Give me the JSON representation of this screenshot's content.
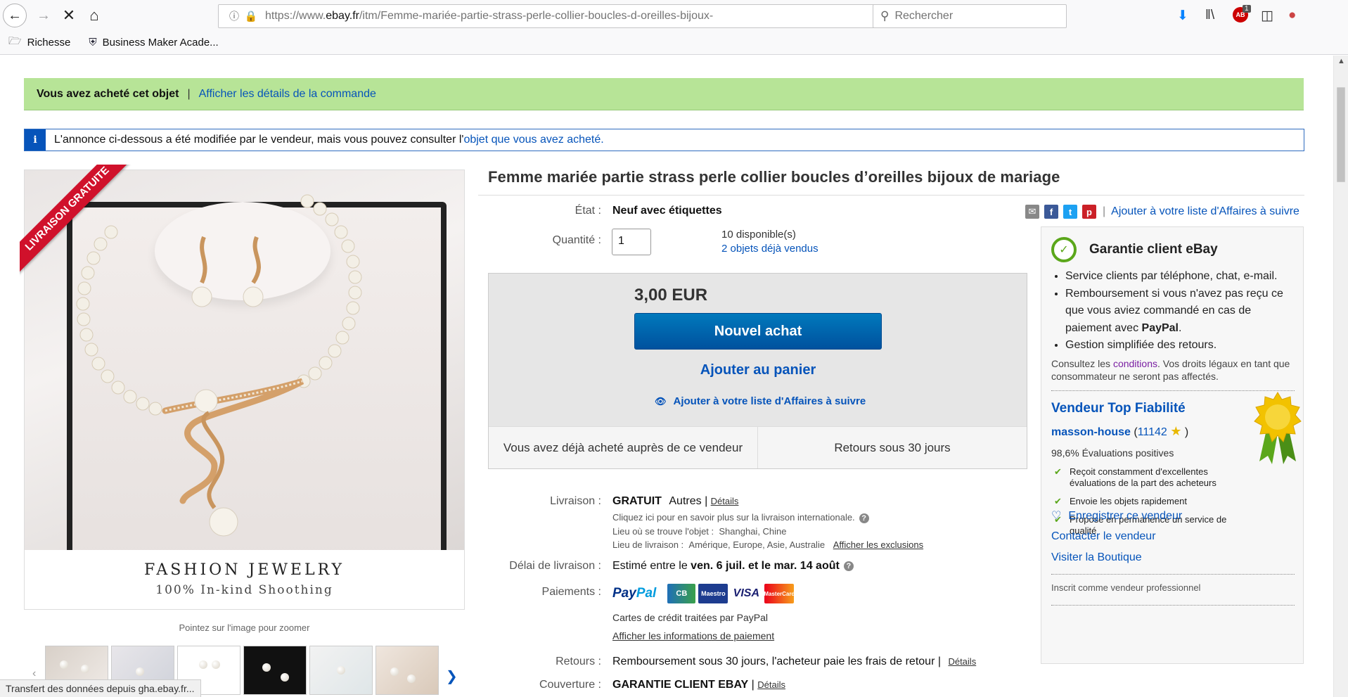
{
  "browser": {
    "url_prefix": "https://www.",
    "url_domain": "ebay.fr",
    "url_path": "/itm/Femme-mariée-partie-strass-perle-collier-boucles-d-oreilles-bijoux-",
    "search_placeholder": "Rechercher",
    "adblock_badge": "1",
    "bookmarks": [
      "Richesse",
      "Business Maker Acade..."
    ],
    "status_text": "Transfert des données depuis gha.ebay.fr..."
  },
  "banner": {
    "purchased": "Vous avez acheté cet objet",
    "separator": "|",
    "order_link": "Afficher les détails de la commande"
  },
  "notice": {
    "text": "L'annonce ci-dessous a été modifiée par le vendeur, mais vous pouvez consulter l'",
    "link": "objet que vous avez acheté."
  },
  "gallery": {
    "ribbon": "LIVRAISON GRATUITE",
    "brand_line1": "FASHION JEWELRY",
    "brand_line2": "100% In-kind  Shoothing",
    "zoom_hint": "Pointez sur l'image pour zoomer"
  },
  "item": {
    "title": "Femme mariée partie strass perle collier boucles d’oreilles bijoux de mariage",
    "condition_label": "État :",
    "condition": "Neuf avec étiquettes",
    "quantity_label": "Quantité :",
    "quantity_value": "1",
    "available": "10 disponible(s)",
    "sold_link": "2 objets déjà vendus",
    "watch_top": "Ajouter à votre liste d'Affaires à suivre"
  },
  "buybox": {
    "price": "3,00 EUR",
    "buy_button": "Nouvel achat",
    "cart_button": "Ajouter au panier",
    "watch_link": "Ajouter à votre liste d'Affaires à suivre",
    "already_bought": "Vous avez déjà acheté auprès de ce vendeur",
    "returns": "Retours sous 30 jours"
  },
  "shipping": {
    "label": "Livraison :",
    "free": "GRATUIT",
    "others": "Autres |",
    "details_link": "Détails",
    "intl_note": "Cliquez ici pour en savoir plus sur la livraison internationale.",
    "location_label": "Lieu où se trouve l'objet :",
    "location": "Shanghai, Chine",
    "dest_label": "Lieu de livraison :",
    "dest": "Amérique, Europe, Asie, Australie",
    "exclusions_link": "Afficher les exclusions",
    "delay_label": "Délai de livraison :",
    "delay_prefix": "Estimé entre le",
    "delay_dates": "ven. 6 juil. et le mar. 14 août",
    "payments_label": "Paiements :",
    "cards_note": "Cartes de crédit traitées par PayPal",
    "payment_info_link": "Afficher les informations de paiement",
    "returns_label": "Retours :",
    "returns_text": "Remboursement sous 30 jours, l'acheteur paie les frais de retour |",
    "returns_details": "Détails",
    "coverage_label": "Couverture :",
    "coverage_text": "GARANTIE CLIENT EBAY",
    "coverage_sep": "|",
    "coverage_details": "Détails",
    "paypal_a": "Pay",
    "paypal_b": "Pal",
    "card_cb": "CB",
    "card_maestro": "Maestro",
    "card_visa": "VISA",
    "card_mc": "MasterCard"
  },
  "guarantee": {
    "title": "Garantie client eBay",
    "items": [
      "Service clients par téléphone, chat, e-mail.",
      "Remboursement si vous n'avez pas reçu ce que vous aviez commandé en cas de paiement avec ",
      "Gestion simplifiée des retours."
    ],
    "paypal_bold": "PayPal",
    "note_prefix": "Consultez les ",
    "note_link": "conditions",
    "note_suffix": ". Vos droits légaux en tant que consommateur ne seront pas affectés."
  },
  "seller": {
    "top_label": "Vendeur Top Fiabilité",
    "name": "masson-house",
    "score": "11142",
    "positive": "98,6% Évaluations positives",
    "checks": [
      "Reçoit constamment d'excellentes évaluations de la part des acheteurs",
      "Envoie les objets rapidement",
      "Propose en permanence un service de qualité"
    ],
    "save_link": "Enregistrer ce vendeur",
    "contact_link": "Contacter le vendeur",
    "shop_link": "Visiter la Boutique",
    "pro": "Inscrit comme vendeur professionnel"
  },
  "colors": {
    "ebay_blue": "#0654ba",
    "banner_green": "#b7e497",
    "buy_button": "#0062b0",
    "ribbon_red": "#d0112b"
  }
}
